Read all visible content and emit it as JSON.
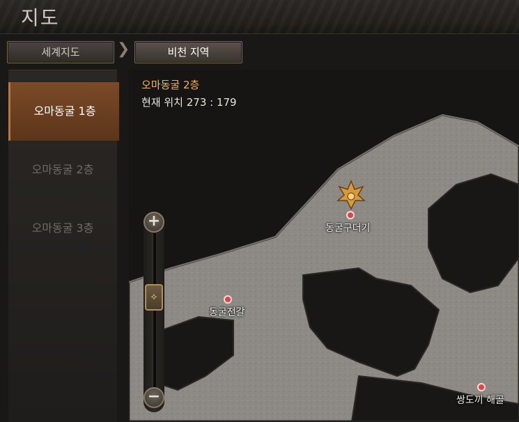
{
  "header": {
    "title": "지도"
  },
  "breadcrumb": {
    "world": "세계지도",
    "arrow": "❯",
    "region": "비천 지역"
  },
  "sidebar": {
    "floors": [
      {
        "label": "오마동굴 1층",
        "active": true
      },
      {
        "label": "오마동굴 2층",
        "active": false
      },
      {
        "label": "오마동굴 3층",
        "active": false
      }
    ]
  },
  "map": {
    "location_name": "오마동굴 2층",
    "position_label": "현재 위치 273 : 179",
    "markers": [
      {
        "name": "동굴구더기",
        "boss": true
      },
      {
        "name": "동굴전갈",
        "boss": false
      },
      {
        "name": "쌍도끼 해골",
        "boss": false
      }
    ]
  },
  "zoom": {
    "in": "+",
    "out": "−",
    "handle": "⟡"
  },
  "colors": {
    "accent": "#f2b450",
    "active_tab": "#7a4a28",
    "marker": "#e04545"
  }
}
